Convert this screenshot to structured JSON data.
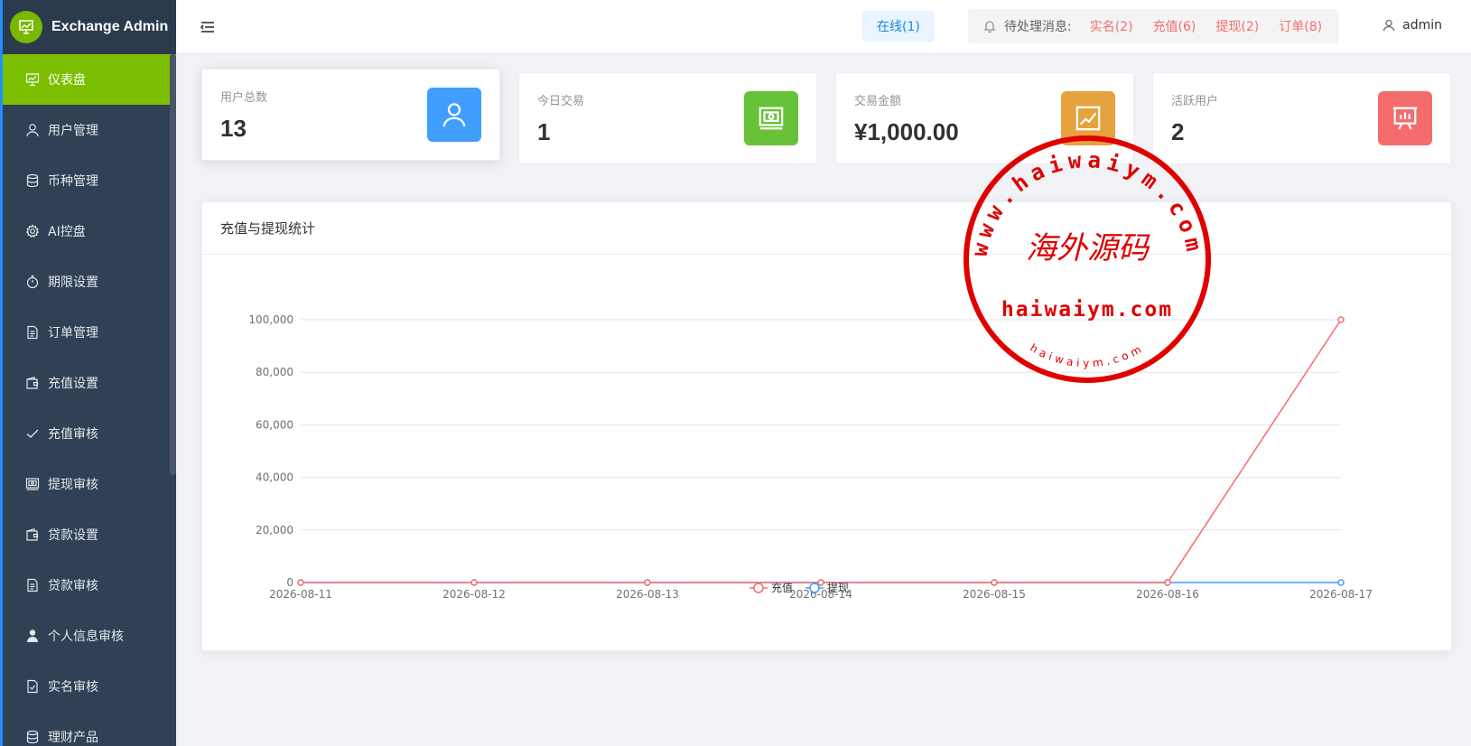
{
  "brand": {
    "title": "Exchange Admin"
  },
  "sidebar": {
    "items": [
      {
        "label": "仪表盘",
        "icon": "dashboard-icon",
        "active": true
      },
      {
        "label": "用户管理",
        "icon": "user-icon"
      },
      {
        "label": "币种管理",
        "icon": "database-icon"
      },
      {
        "label": "AI控盘",
        "icon": "gear-icon"
      },
      {
        "label": "期限设置",
        "icon": "stopwatch-icon"
      },
      {
        "label": "订单管理",
        "icon": "document-icon"
      },
      {
        "label": "充值设置",
        "icon": "wallet-icon"
      },
      {
        "label": "充值审核",
        "icon": "check-icon"
      },
      {
        "label": "提现审核",
        "icon": "money-icon"
      },
      {
        "label": "贷款设置",
        "icon": "wallet-icon"
      },
      {
        "label": "贷款审核",
        "icon": "document-icon"
      },
      {
        "label": "个人信息审核",
        "icon": "person-filled-icon"
      },
      {
        "label": "实名审核",
        "icon": "document-check-icon"
      },
      {
        "label": "理财产品",
        "icon": "database-icon"
      }
    ]
  },
  "header": {
    "online": "在线(1)",
    "notice_label": "待处理消息:",
    "notices": [
      "实名(2)",
      "充值(6)",
      "提现(2)",
      "订单(8)"
    ],
    "user": "admin"
  },
  "stats": [
    {
      "label": "用户总数",
      "value": "13",
      "color": "#409eff",
      "icon": "user-icon"
    },
    {
      "label": "今日交易",
      "value": "1",
      "color": "#67c23a",
      "icon": "money-icon"
    },
    {
      "label": "交易金额",
      "value": "¥1,000.00",
      "color": "#e6a23c",
      "icon": "trend-icon"
    },
    {
      "label": "活跃用户",
      "value": "2",
      "color": "#f56c6c",
      "icon": "presentation-icon"
    }
  ],
  "chart": {
    "title": "充值与提现统计"
  },
  "chart_data": {
    "type": "line",
    "x": [
      "2026-08-11",
      "2026-08-12",
      "2026-08-13",
      "2026-08-14",
      "2026-08-15",
      "2026-08-16",
      "2026-08-17"
    ],
    "series": [
      {
        "name": "充值",
        "values": [
          0,
          0,
          0,
          0,
          0,
          0,
          100000
        ],
        "color": "#f56c6c"
      },
      {
        "name": "提现",
        "values": [
          0,
          0,
          0,
          0,
          0,
          0,
          0
        ],
        "color": "#409eff"
      }
    ],
    "yticks": [
      "100,000",
      "80,000",
      "60,000",
      "40,000",
      "20,000",
      "0"
    ],
    "ylim": [
      0,
      100000
    ],
    "grid": true,
    "legend": "bottom-center"
  },
  "watermark": {
    "text_cn": "海外源码",
    "text_main": "haiwaiym.com",
    "text_ring": "www.haiwaiym.com",
    "text_small": "haiwaiym.com",
    "color": "#e00000"
  }
}
